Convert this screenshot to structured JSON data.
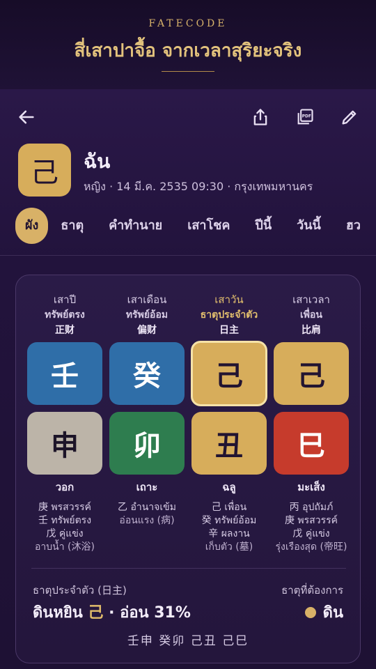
{
  "header": {
    "brand": "FATECODE",
    "tagline": "สี่เสาปาจื้อ จากเวลาสุริยะจริง"
  },
  "toolbar": {
    "back_icon": "arrow-left-icon",
    "share_icon": "share-icon",
    "pdf_icon": "pdf-icon",
    "edit_icon": "pencil-icon"
  },
  "profile": {
    "badge_char": "己",
    "name": "ฉัน",
    "meta": "หญิง · 14 มี.ค. 2535 09:30 · กรุงเทพมหานคร"
  },
  "tabs": [
    {
      "label": "ผัง",
      "active": true
    },
    {
      "label": "ธาตุ"
    },
    {
      "label": "คำทำนาย"
    },
    {
      "label": "เสาโชค"
    },
    {
      "label": "ปีนี้"
    },
    {
      "label": "วันนี้"
    },
    {
      "label": "ฮว"
    }
  ],
  "pillars": [
    {
      "head": "เสาปี",
      "god_th": "ทรัพย์ตรง",
      "god_cn": "正财",
      "stem": "壬",
      "branch": "申",
      "animal": "วอก",
      "hidden": [
        "庚 พรสวรรค์",
        "壬 ทรัพย์ตรง",
        "戊 คู่แข่ง"
      ],
      "phase": "อาบน้ำ (沐浴)",
      "stem_color": "#2f6ea8",
      "branch_color": "#bcb4a8",
      "stem_text": "#ffffff",
      "branch_text": "#1c1428"
    },
    {
      "head": "เสาเดือน",
      "god_th": "ทรัพย์อ้อม",
      "god_cn": "偏财",
      "stem": "癸",
      "branch": "卯",
      "animal": "เถาะ",
      "hidden": [
        "乙 อำนาจเข้ม"
      ],
      "phase": "อ่อนแรง (病)",
      "stem_color": "#2f6ea8",
      "branch_color": "#2e7d4f",
      "stem_text": "#ffffff",
      "branch_text": "#ffffff"
    },
    {
      "head": "เสาวัน",
      "god_th": "ธาตุประจำตัว",
      "god_cn": "日主",
      "stem": "己",
      "branch": "丑",
      "animal": "ฉลู",
      "hidden": [
        "己 เพื่อน",
        "癸 ทรัพย์อ้อม",
        "辛 ผลงาน"
      ],
      "phase": "เก็บตัว (墓)",
      "stem_color": "#d7ad5b",
      "branch_color": "#d7ad5b",
      "stem_text": "#221431",
      "branch_text": "#221431",
      "highlight": true
    },
    {
      "head": "เสาเวลา",
      "god_th": "เพื่อน",
      "god_cn": "比肩",
      "stem": "己",
      "branch": "巳",
      "animal": "มะเส็ง",
      "hidden": [
        "丙 อุปถัมภ์",
        "庚 พรสวรรค์",
        "戊 คู่แข่ง"
      ],
      "phase": "รุ่งเรืองสุด (帝旺)",
      "stem_color": "#d7ad5b",
      "branch_color": "#c63b2c",
      "stem_text": "#221431",
      "branch_text": "#ffffff"
    }
  ],
  "daymaster": {
    "label": "ธาตุประจำตัว (日主)",
    "value_prefix": "ดินหยิน ",
    "value_char": "己",
    "value_suffix": " · อ่อน 31%"
  },
  "needed": {
    "label": "ธาตุที่ต้องการ",
    "value": "ดิน",
    "dot_color": "#d8b167"
  },
  "pillars_line": "壬申 癸卯 己丑 己巳"
}
